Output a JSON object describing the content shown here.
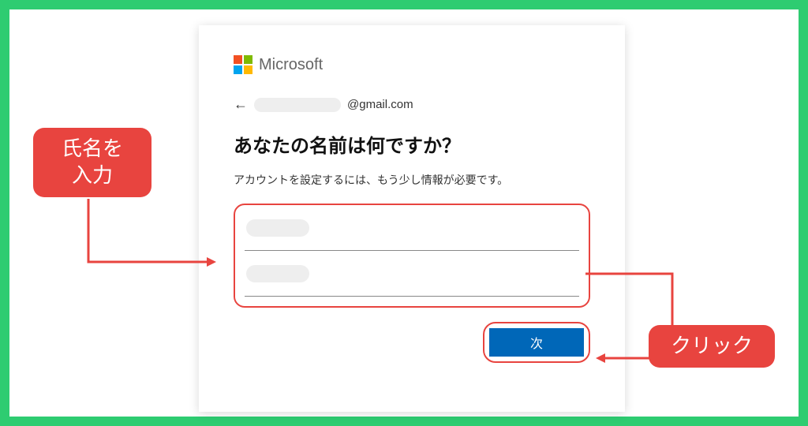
{
  "brand": "Microsoft",
  "email_suffix": "@gmail.com",
  "heading": "あなたの名前は何ですか？",
  "subtext": "アカウントを設定するには、もう少し情報が必要です。",
  "next_button": "次",
  "callout_name": "氏名を\n入力",
  "callout_click": "クリック",
  "colors": {
    "accent_red": "#e8443f",
    "ms_blue": "#0067b8",
    "border_green": "#2ecc71"
  }
}
